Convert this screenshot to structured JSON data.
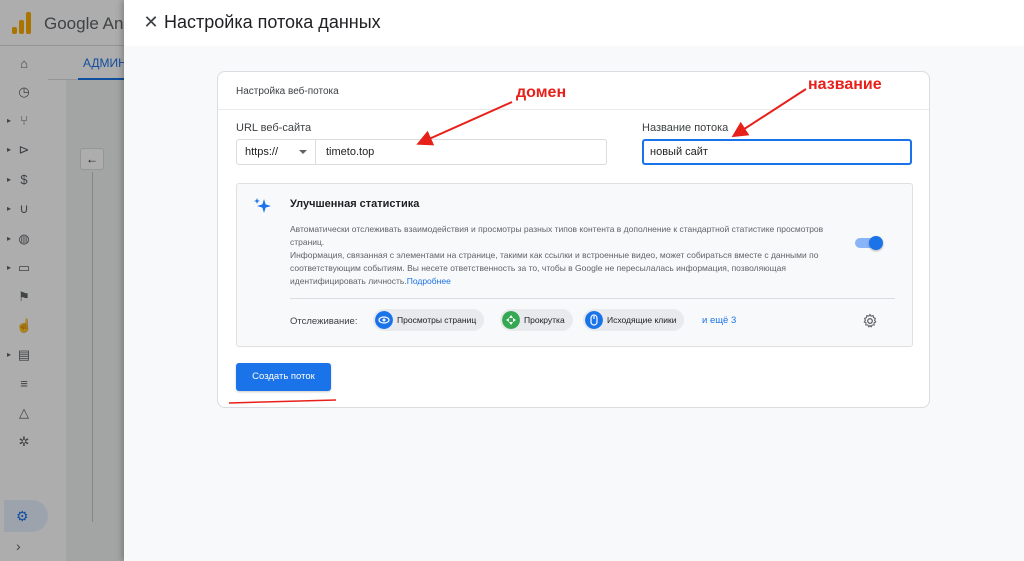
{
  "background_app": {
    "title": "Google Ana",
    "tab_label": "АДМИН"
  },
  "panel": {
    "title": "Настройка потока данных"
  },
  "card": {
    "title": "Настройка веб-потока",
    "url_label": "URL веб-сайта",
    "protocol_value": "https://",
    "url_value": "timeto.top",
    "name_label": "Название потока",
    "name_value": "новый сайт"
  },
  "enhanced": {
    "title": "Улучшенная статистика",
    "desc_line1": "Автоматически отслеживать взаимодействия и просмотры разных типов контента в дополнение к стандартной статистике просмотров страниц.",
    "desc_line2": "Информация, связанная с элементами на странице, такими как ссылки и встроенные видео, может собираться вместе с данными по соответствующим событиям. Вы несете ответственность за то, чтобы в Google не пересылалась информация, позволяющая идентифицировать личность.",
    "more_link": "Подробнее",
    "toggle_on": true,
    "tracking_label": "Отслеживание:",
    "chips": [
      {
        "label": "Просмотры страниц",
        "icon": "eye-icon",
        "color": "#1a73e8"
      },
      {
        "label": "Прокрутка",
        "icon": "scroll-icon",
        "color": "#34a853"
      },
      {
        "label": "Исходящие клики",
        "icon": "mouse-icon",
        "color": "#1a73e8"
      }
    ],
    "more_count": "и ещё 3"
  },
  "buttons": {
    "create": "Создать поток"
  },
  "annotations": {
    "domain": "домен",
    "name": "название",
    "color": "#e8201a"
  }
}
